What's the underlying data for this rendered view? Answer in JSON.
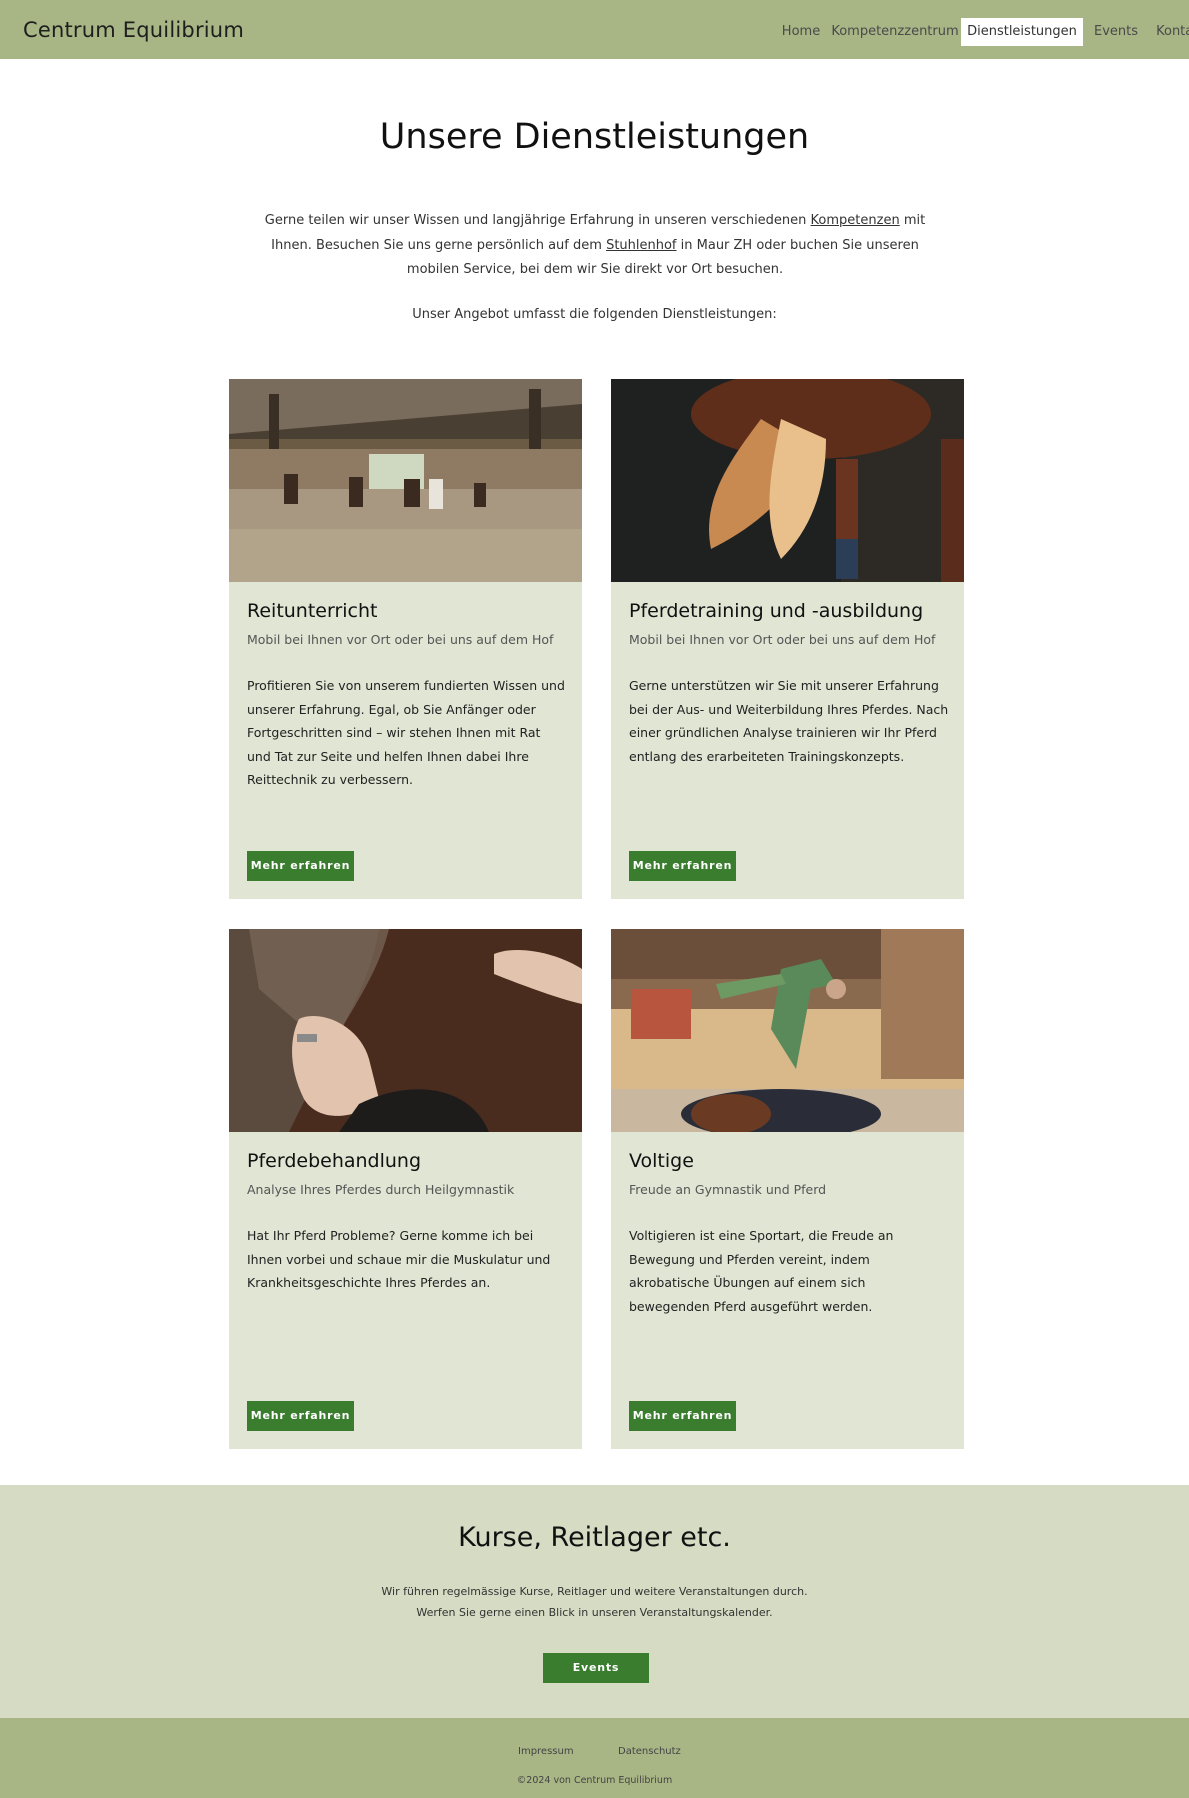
{
  "header": {
    "logo": "Centrum Equilibrium",
    "nav": [
      "Home",
      "Kompetenzzentrum",
      "Dienstleistungen",
      "Events",
      "Kontakt"
    ],
    "active": "Dienstleistungen"
  },
  "main": {
    "title": "Unsere Dienstleistungen",
    "intro_1": "Gerne teilen wir unser Wissen und langjährige Erfahrung in unseren verschiedenen ",
    "intro_link_1": "Kompetenzen",
    "intro_2": " mit Ihnen. Besuchen Sie uns gerne persönlich auf dem ",
    "intro_link_2": "Stuhlenhof",
    "intro_3": " in Maur ZH oder buchen Sie unseren mobilen Service, bei dem wir Sie direkt vor Ort besuchen.",
    "offer": "Unser Angebot umfasst die folgenden Dienstleistungen:"
  },
  "cards": [
    {
      "title": "Reitunterricht",
      "subtitle": "Mobil bei Ihnen vor Ort oder bei uns auf dem Hof",
      "text": "Profitieren Sie von unserem fundierten Wissen und unserer Erfahrung. Egal, ob Sie Anfänger oder Fortgeschritten sind – wir stehen Ihnen mit Rat und Tat zur Seite und helfen Ihnen dabei Ihre Reittechnik zu verbessern.",
      "button": "Mehr erfahren",
      "image": "riding-arena-photo"
    },
    {
      "title": "Pferdetraining und -ausbildung",
      "subtitle": "Mobil bei Ihnen vor Ort oder bei uns auf dem Hof",
      "text": "Gerne unterstützen wir Sie mit unserer Erfahrung bei der Aus- und Weiterbildung Ihres Pferdes. Nach einer gründlichen Analyse trainieren wir Ihr Pferd entlang des erarbeiteten Trainingskonzepts.",
      "button": "Mehr erfahren",
      "image": "horse-tail-photo"
    },
    {
      "title": "Pferdebehandlung",
      "subtitle": "Analyse Ihres Pferdes durch Heilgymnastik",
      "text": "Hat Ihr Pferd Probleme? Gerne komme ich bei Ihnen vorbei und schaue mir die Muskulatur und Krankheitsgeschichte Ihres Pferdes an.",
      "button": "Mehr erfahren",
      "image": "hand-on-horse-photo"
    },
    {
      "title": "Voltige",
      "subtitle": "Freude an Gymnastik und Pferd",
      "text": "Voltigieren ist eine Sportart, die Freude an Bewegung und Pferden vereint, indem akrobatische Übungen auf einem sich bewegenden Pferd ausgeführt werden.",
      "button": "Mehr erfahren",
      "image": "vaulting-photo"
    }
  ],
  "events": {
    "title": "Kurse, Reitlager etc.",
    "line_1": "Wir führen regelmässige Kurse, Reitlager und weitere Veranstaltungen durch.",
    "line_2": "Werfen Sie gerne einen Blick in unseren Veranstaltungskalender.",
    "button": "Events"
  },
  "footer": {
    "impressum": "Impressum",
    "datenschutz": "Datenschutz",
    "copyright": "©2024 von Centrum Equilibrium"
  },
  "colors": {
    "header_bg": "#a8b585",
    "card_bg": "#e0e5d4",
    "band_bg": "#d6dbc4",
    "button": "#3a7d2e"
  }
}
